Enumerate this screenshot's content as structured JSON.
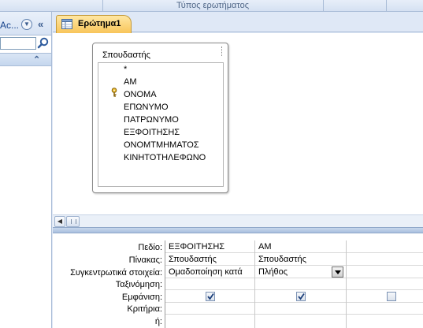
{
  "ribbon": {
    "group_label": "Τύπος ερωτήματος"
  },
  "nav": {
    "title": "Ac...",
    "search_placeholder": ""
  },
  "document": {
    "tab_label": "Ερώτημα1"
  },
  "table_box": {
    "title": "Σπουδαστής",
    "fields": [
      "*",
      "AM",
      "ONOMA",
      "ΕΠΩΝΥΜΟ",
      "ΠΑΤΡΩΝΥΜΟ",
      "ΕΞΦΟΙΤΗΣΗΣ",
      "ΟΝΟΜΤΜΗΜΑΤΟΣ",
      "ΚΙΝΗΤΟΤΗΛΕΦΩΝΟ"
    ],
    "key_field": "AM"
  },
  "grid": {
    "row_labels": [
      "Πεδίο:",
      "Πίνακας:",
      "Συγκεντρωτικά στοιχεία:",
      "Ταξινόμηση:",
      "Εμφάνιση:",
      "Κριτήρια:",
      "ή:"
    ],
    "columns": [
      {
        "field": "ΕΞΦΟΙΤΗΣΗΣ",
        "table": "Σπουδαστής",
        "total": "Ομαδοποίηση κατά",
        "sort": "",
        "show": true,
        "criteria": "",
        "or": ""
      },
      {
        "field": "AM",
        "table": "Σπουδαστής",
        "total": "Πλήθος",
        "sort": "",
        "show": true,
        "criteria": "",
        "or": ""
      },
      {
        "field": "",
        "table": "",
        "total": "",
        "sort": "",
        "show": false,
        "criteria": "",
        "or": ""
      }
    ]
  },
  "colors": {
    "tab_active": "#f8c55a",
    "frame": "#dfe8f6",
    "nav_text": "#15428b"
  }
}
